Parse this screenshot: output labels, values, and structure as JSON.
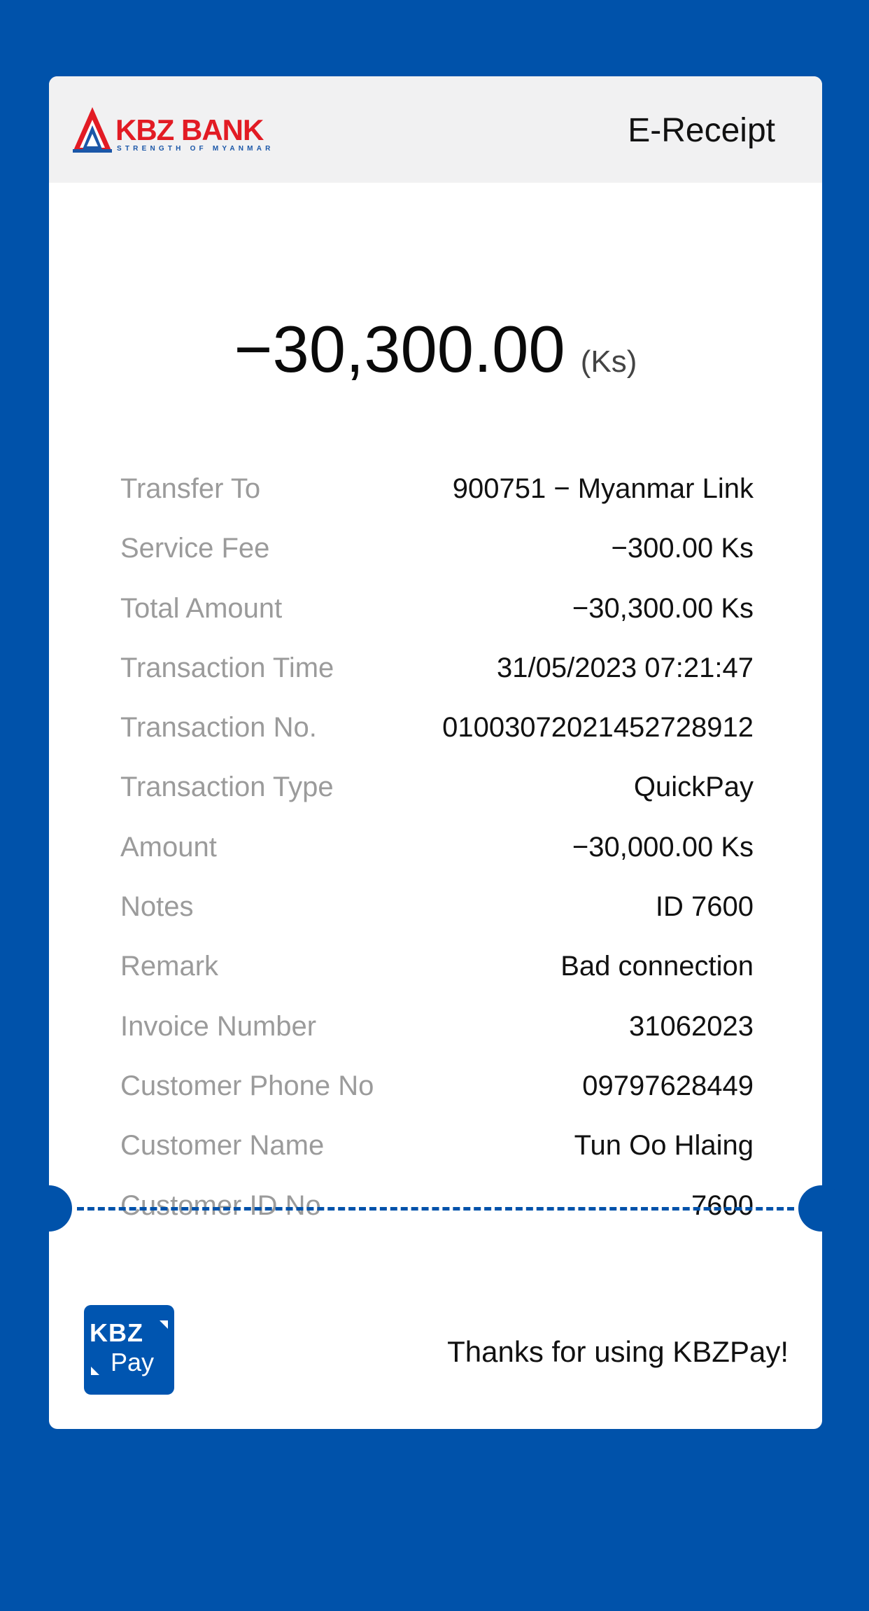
{
  "header": {
    "logo_name": "KBZ BANK",
    "logo_tagline": "STRENGTH OF MYANMAR",
    "title": "E-Receipt"
  },
  "amount": {
    "value": "−30,300.00",
    "unit": "(Ks)"
  },
  "details": [
    {
      "label": "Transfer To",
      "value": "900751 − Myanmar Link"
    },
    {
      "label": "Service Fee",
      "value": "−300.00 Ks"
    },
    {
      "label": "Total Amount",
      "value": "−30,300.00 Ks"
    },
    {
      "label": "Transaction Time",
      "value": "31/05/2023 07:21:47"
    },
    {
      "label": "Transaction No.",
      "value": "01003072021452728912"
    },
    {
      "label": "Transaction Type",
      "value": "QuickPay"
    },
    {
      "label": "Amount",
      "value": "−30,000.00 Ks"
    },
    {
      "label": "Notes",
      "value": "ID 7600"
    },
    {
      "label": "Remark",
      "value": "Bad connection"
    },
    {
      "label": "Invoice Number",
      "value": "31062023"
    },
    {
      "label": "Customer Phone No",
      "value": "09797628449"
    },
    {
      "label": "Customer Name",
      "value": "Tun Oo Hlaing"
    },
    {
      "label": "Customer ID No",
      "value": "7600"
    }
  ],
  "footer": {
    "pay_logo_top": "KBZ",
    "pay_logo_bottom": "Pay",
    "thanks": "Thanks for using KBZPay!"
  },
  "colors": {
    "background": "#0052aa",
    "brand_red": "#e21b24",
    "brand_blue": "#1b57a8",
    "label_gray": "#9b9b9b"
  },
  "icons": {
    "bank_logo": "kbz-triangle-logo-icon",
    "pay_logo": "kbzpay-logo-icon"
  }
}
